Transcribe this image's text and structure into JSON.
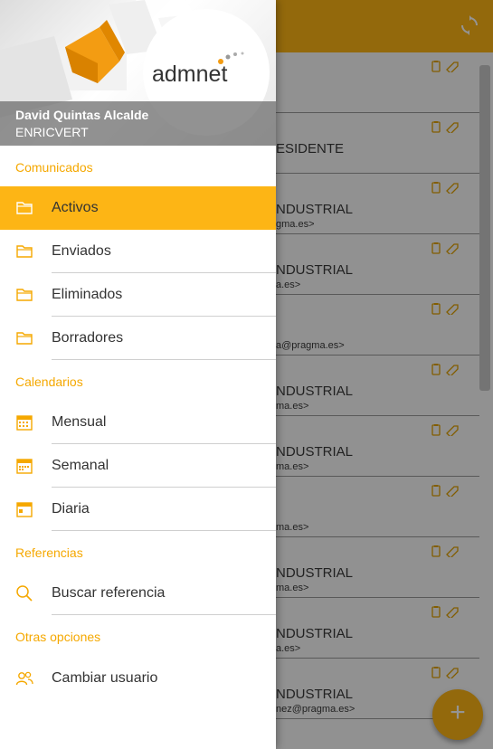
{
  "colors": {
    "accent": "#fdb515",
    "section_text": "#f5a800",
    "overlay": "rgba(0,0,0,0.42)"
  },
  "app": {
    "refresh_icon": "refresh-icon",
    "fab_label": "+",
    "messages": [
      {
        "subject": "",
        "from": ""
      },
      {
        "subject": "ESIDENTE",
        "from": ""
      },
      {
        "subject": "NDUSTRIAL",
        "from": "gma.es>"
      },
      {
        "subject": "NDUSTRIAL",
        "from": "a.es>"
      },
      {
        "subject": "",
        "from": "a@pragma.es>"
      },
      {
        "subject": "NDUSTRIAL",
        "from": "ma.es>"
      },
      {
        "subject": "NDUSTRIAL",
        "from": "ma.es>"
      },
      {
        "subject": "",
        "from": "ma.es>"
      },
      {
        "subject": "NDUSTRIAL",
        "from": "ma.es>"
      },
      {
        "subject": "NDUSTRIAL",
        "from": "a.es>"
      },
      {
        "subject": "NDUSTRIAL",
        "from": "nez@pragma.es>"
      }
    ]
  },
  "drawer": {
    "logo_text": "admnet",
    "user_name": "David Quintas Alcalde",
    "user_company": "ENRICVERT",
    "sections": {
      "comunicados": "Comunicados",
      "calendarios": "Calendarios",
      "referencias": "Referencias",
      "otras": "Otras opciones"
    },
    "items": {
      "activos": "Activos",
      "enviados": "Enviados",
      "eliminados": "Eliminados",
      "borradores": "Borradores",
      "mensual": "Mensual",
      "semanal": "Semanal",
      "diaria": "Diaria",
      "buscar": "Buscar referencia",
      "cambiar": "Cambiar usuario"
    }
  }
}
